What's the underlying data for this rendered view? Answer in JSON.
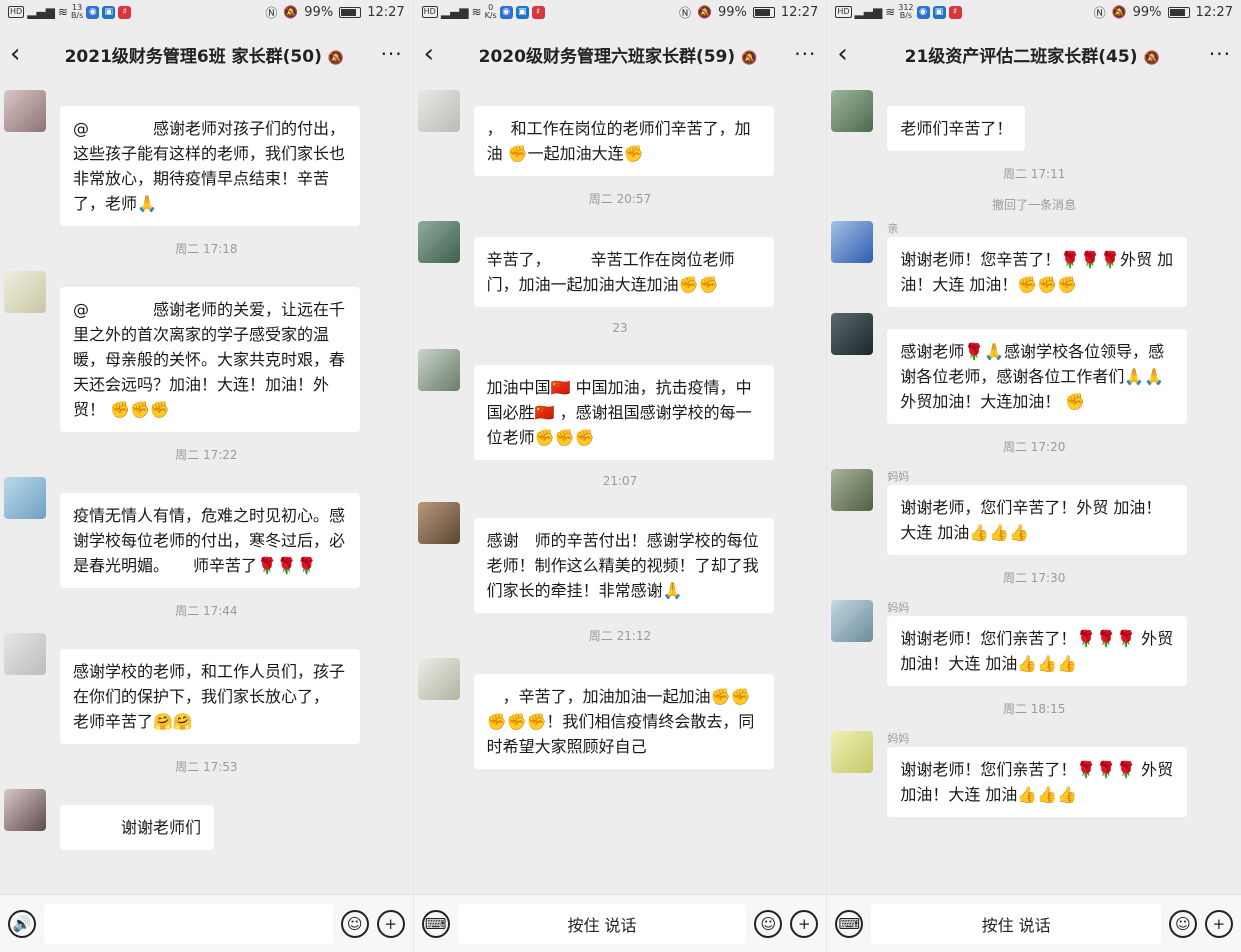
{
  "status": {
    "hd": "HD",
    "net": "⁴⁶",
    "screens": [
      {
        "speed_val": "13",
        "speed_unit": "B/s"
      },
      {
        "speed_val": "0",
        "speed_unit": "K/s"
      },
      {
        "speed_val": "312",
        "speed_unit": "B/s"
      }
    ],
    "battery": "99%",
    "time": "12:27"
  },
  "screens": [
    {
      "title": "2021级财务管理6班 家长群(50)",
      "items": [
        {
          "kind": "msg",
          "avatar": [
            "#d8c6c6",
            "#8e7474"
          ],
          "sender": "",
          "text": "@　　　　感谢老师对孩子们的付出，这些孩子能有这样的老师，我们家长也非常放心，期待疫情早点结束！辛苦了，老师🙏"
        },
        {
          "kind": "time",
          "text": "周二 17:18"
        },
        {
          "kind": "msg",
          "avatar": [
            "#eeeedd",
            "#c9c7a6"
          ],
          "sender": "",
          "text": "@　　　　感谢老师的关爱，让远在千里之外的首次离家的学子感受家的温暖，母亲般的关怀。大家共克时艰，春天还会远吗？加油！大连！加油！外贸！ ✊✊✊"
        },
        {
          "kind": "time",
          "text": "周二 17:22"
        },
        {
          "kind": "msg",
          "avatar": [
            "#bcd8ea",
            "#6ea1c4"
          ],
          "sender": "",
          "text": "疫情无情人有情，危难之时见初心。感谢学校每位老师的付出，寒冬过后，必是春光明媚。　　师辛苦了🌹🌹🌹"
        },
        {
          "kind": "time",
          "text": "周二 17:44"
        },
        {
          "kind": "msg",
          "avatar": [
            "#e6e6e6",
            "#bdbdbd"
          ],
          "sender": "",
          "text": "感谢学校的老师，和工作人员们，孩子在你们的保护下，我们家长放心了，　　　老师辛苦了🤗🤗"
        },
        {
          "kind": "time",
          "text": "周二 17:53"
        },
        {
          "kind": "msg",
          "avatar": [
            "#d8c7c7",
            "#5d4b4b"
          ],
          "sender": "",
          "text": "　　　谢谢老师们"
        }
      ],
      "bottom": {
        "mode": "input",
        "left_icon": "🔊",
        "emoji": "☺",
        "plus": "+"
      }
    },
    {
      "title": "2020级财务管理六班家长群(59)",
      "items": [
        {
          "kind": "msg",
          "avatar": [
            "#e8e8e6",
            "#b9bcb5"
          ],
          "sender": "",
          "text": "，　和工作在岗位的老师们辛苦了，加油 ✊一起加油大连✊"
        },
        {
          "kind": "time",
          "text": "周二 20:57"
        },
        {
          "kind": "msg",
          "avatar": [
            "#8fae9e",
            "#3f5e4c"
          ],
          "sender": "",
          "text": "辛苦了，　　　辛苦工作在岗位老师门，加油一起加油大连加油✊✊"
        },
        {
          "kind": "time",
          "text": "23"
        },
        {
          "kind": "msg",
          "avatar": [
            "#c8d4c8",
            "#6a7d6a"
          ],
          "sender": "",
          "text": "加油中国🇨🇳 中国加油，抗击疫情，中国必胜🇨🇳 ，感谢祖国感谢学校的每一位老师✊✊✊"
        },
        {
          "kind": "time",
          "text": "21:07"
        },
        {
          "kind": "msg",
          "avatar": [
            "#b89a7a",
            "#5b4633"
          ],
          "sender": "",
          "text": "感谢　师的辛苦付出！感谢学校的每位老师！制作这么精美的视频！了却了我们家长的牵挂！非常感谢🙏"
        },
        {
          "kind": "time",
          "text": "周二 21:12"
        },
        {
          "kind": "msg",
          "avatar": [
            "#ecece4",
            "#b3b3a3"
          ],
          "sender": "",
          "text": "　，辛苦了，加油加油一起加油✊✊✊✊✊！我们相信疫情终会散去，同时希望大家照顾好自己"
        }
      ],
      "bottom": {
        "mode": "hold",
        "kb_icon": "⌨",
        "talk": "按住 说话",
        "emoji": "☺",
        "plus": "+"
      }
    },
    {
      "title": "21级资产评估二班家长群(45)",
      "items": [
        {
          "kind": "msg",
          "avatar": [
            "#9db59c",
            "#4d6a4d"
          ],
          "sender": "",
          "text": "老师们辛苦了！"
        },
        {
          "kind": "time",
          "text": "周二 17:11"
        },
        {
          "kind": "recall",
          "text": "撤回了一条消息"
        },
        {
          "kind": "msg",
          "avatar": [
            "#a4c0e4",
            "#2f5cb0"
          ],
          "sender": "亲",
          "text": "谢谢老师！您辛苦了！🌹🌹🌹外贸 加油！大连 加油！✊✊✊"
        },
        {
          "kind": "msg",
          "avatar": [
            "#5a6a6e",
            "#1c2629"
          ],
          "sender": "",
          "text": "感谢老师🌹🙏感谢学校各位领导，感谢各位老师，感谢各位工作者们🙏🙏外贸加油！大连加油！ ✊"
        },
        {
          "kind": "time",
          "text": "周二 17:20"
        },
        {
          "kind": "msg",
          "avatar": [
            "#a8b49c",
            "#505f41"
          ],
          "sender": "妈妈",
          "text": "谢谢老师，您们辛苦了！外贸 加油！大连 加油👍👍👍"
        },
        {
          "kind": "time",
          "text": "周二 17:30"
        },
        {
          "kind": "msg",
          "avatar": [
            "#c4d8e4",
            "#6b8c98"
          ],
          "sender": "妈妈",
          "text": "谢谢老师！您们亲苦了！🌹🌹🌹 外贸 加油！大连 加油👍👍👍"
        },
        {
          "kind": "time",
          "text": "周二 18:15"
        },
        {
          "kind": "msg",
          "avatar": [
            "#eef0b4",
            "#c6c86a"
          ],
          "sender": "妈妈",
          "text": "谢谢老师！您们亲苦了！🌹🌹🌹 外贸 加油！大连 加油👍👍👍"
        }
      ],
      "bottom": {
        "mode": "hold",
        "kb_icon": "⌨",
        "talk": "按住 说话",
        "emoji": "☺",
        "plus": "+"
      }
    }
  ],
  "header": {
    "back": "‹",
    "mute": "🔕",
    "more": "···"
  }
}
